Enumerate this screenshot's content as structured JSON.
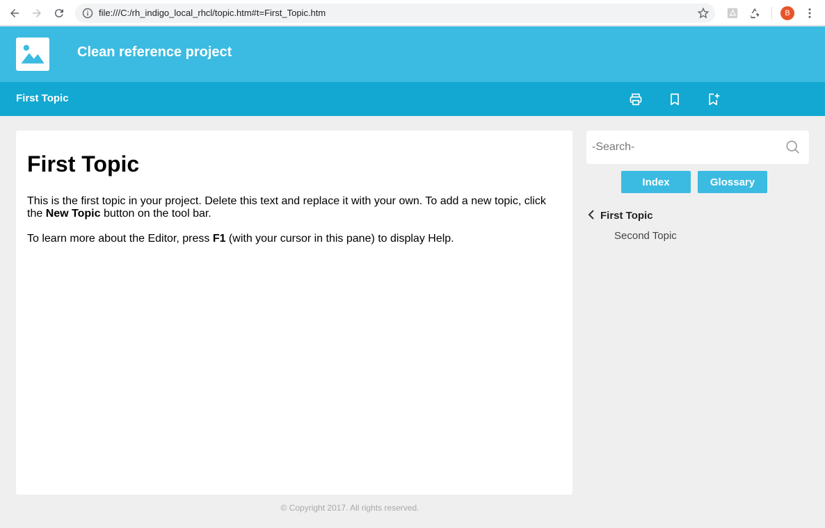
{
  "browser": {
    "url": "file:///C:/rh_indigo_local_rhcl/topic.htm#t=First_Topic.htm",
    "profile_initial": "B",
    "icons": [
      "back-icon",
      "forward-icon",
      "reload-icon",
      "info-icon",
      "star-icon",
      "pdf-extension-icon",
      "recycle-extension-icon",
      "menu-dots-icon"
    ]
  },
  "header": {
    "project_title": "Clean reference project",
    "logo_icon": "image-placeholder-icon"
  },
  "topic_bar": {
    "title": "First Topic",
    "buttons": [
      "print-icon",
      "bookmark-icon",
      "add-bookmark-icon"
    ]
  },
  "content": {
    "heading": "First Topic",
    "p1_before": "This is the first topic in your project. Delete this text and replace it with your own. To add a new topic, click the ",
    "p1_bold": "New Topic",
    "p1_after": " button on the tool bar.",
    "p2_before": "To learn more about the Editor, press ",
    "p2_bold": "F1",
    "p2_after": " (with your cursor in this pane) to display Help."
  },
  "footer": {
    "copyright": "© Copyright 2017. All rights reserved."
  },
  "sidebar": {
    "search_placeholder": "-Search-",
    "index_label": "Index",
    "glossary_label": "Glossary",
    "toc": [
      {
        "label": "First Topic",
        "active": true
      },
      {
        "label": "Second Topic",
        "active": false
      }
    ]
  },
  "colors": {
    "header": "#3bbbe1",
    "topic_bar": "#13a8d1",
    "accent_button": "#3bbbe1",
    "background": "#efefef"
  }
}
